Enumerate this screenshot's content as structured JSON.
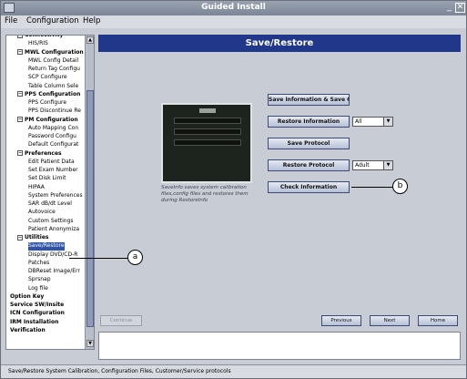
{
  "window": {
    "title": "Guided Install"
  },
  "menu": [
    "File",
    "Configuration",
    "Help"
  ],
  "sidebar": {
    "items": [
      {
        "label": "Connectivity",
        "type": "category"
      },
      {
        "label": "HIS/RIS",
        "type": "item"
      },
      {
        "label": "MWL Configuration",
        "type": "category"
      },
      {
        "label": "MWL Config Detail",
        "type": "item"
      },
      {
        "label": "Return Tag Configu",
        "type": "item"
      },
      {
        "label": "SCP Configure",
        "type": "item"
      },
      {
        "label": "Table Column Sele",
        "type": "item"
      },
      {
        "label": "PPS Configuration",
        "type": "category"
      },
      {
        "label": "PPS Configure",
        "type": "item"
      },
      {
        "label": "PPS Discontinue Re",
        "type": "item"
      },
      {
        "label": "PM Configuration",
        "type": "category"
      },
      {
        "label": "Auto Mapping Con",
        "type": "item"
      },
      {
        "label": "Password Configu",
        "type": "item"
      },
      {
        "label": "Default Configurat",
        "type": "item"
      },
      {
        "label": "Preferences",
        "type": "category"
      },
      {
        "label": "Edit Patient Data",
        "type": "item"
      },
      {
        "label": "Set Exam Number",
        "type": "item"
      },
      {
        "label": "Set Disk Limit",
        "type": "item"
      },
      {
        "label": "HIPAA",
        "type": "item"
      },
      {
        "label": "System Preferences",
        "type": "item"
      },
      {
        "label": "SAR dB/dt Level",
        "type": "item"
      },
      {
        "label": "Autovoice",
        "type": "item"
      },
      {
        "label": "Custom Settings",
        "type": "item"
      },
      {
        "label": "Patient Anonymiza",
        "type": "item"
      },
      {
        "label": "Utilities",
        "type": "category"
      },
      {
        "label": "Save/Restore",
        "type": "item",
        "selected": true
      },
      {
        "label": "Display DVD/CD-R",
        "type": "item"
      },
      {
        "label": "Patches",
        "type": "item"
      },
      {
        "label": "DBReset Image/Err",
        "type": "item"
      },
      {
        "label": "Sprsnap",
        "type": "item"
      },
      {
        "label": "Log file",
        "type": "item"
      },
      {
        "label": "Option Key",
        "type": "top"
      },
      {
        "label": "Service SW/Insite",
        "type": "top"
      },
      {
        "label": "ICN Configuration",
        "type": "top"
      },
      {
        "label": "IRM Installation",
        "type": "top"
      },
      {
        "label": "Verification",
        "type": "top"
      }
    ]
  },
  "main": {
    "header": "Save/Restore",
    "caption": "SaveInfo saves system calibration files,config files and restores them during RestoreInfo",
    "buttons": {
      "save_info": "Save Information & Save GI",
      "restore_info": "Restore Information",
      "save_protocol": "Save Protocol",
      "restore_protocol": "Restore Protocol",
      "check_info": "Check Information"
    },
    "dropdowns": {
      "restore_info_value": "All",
      "restore_protocol_value": "Adult"
    }
  },
  "nav": {
    "continue": "Continue",
    "previous": "Previous",
    "next": "Next",
    "home": "Home"
  },
  "status": "Save/Restore System Calibration, Configuration Files, Customer/Service protocols",
  "callouts": {
    "a": "a",
    "b": "b"
  },
  "colors": {
    "header": "#21378a",
    "selected": "#2f53a8"
  }
}
